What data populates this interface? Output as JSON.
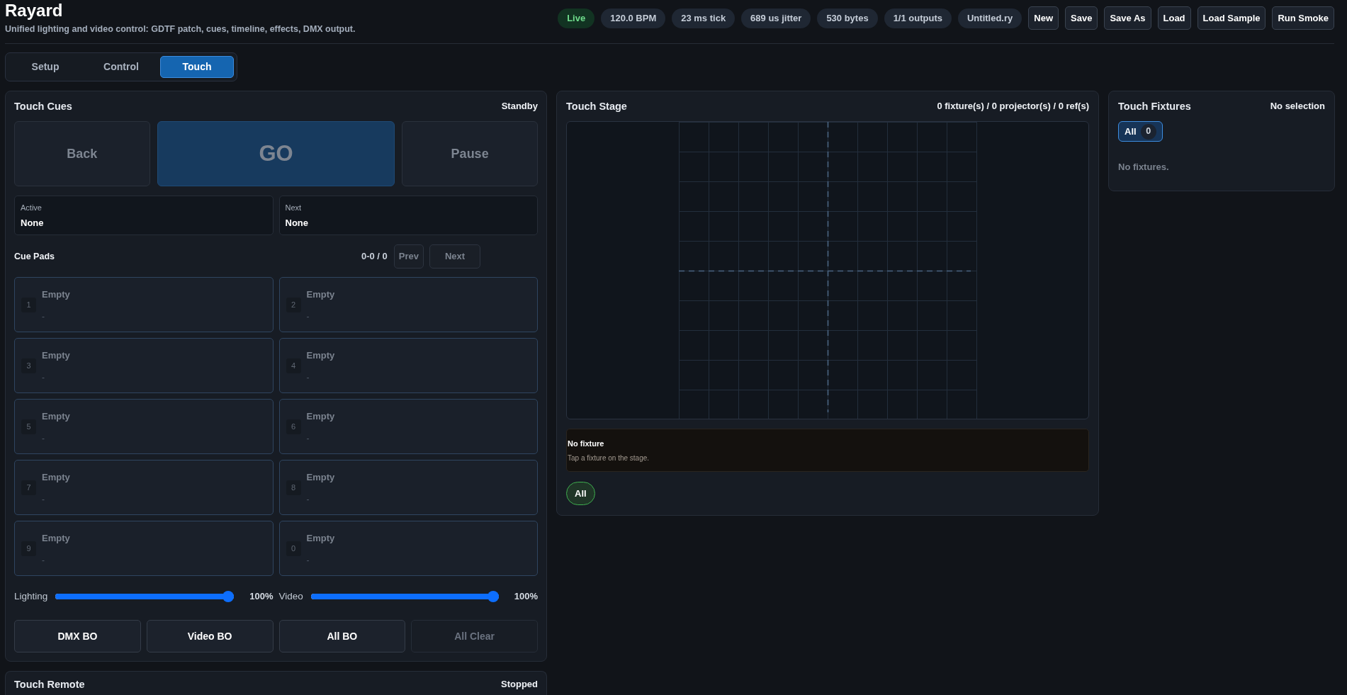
{
  "app": {
    "title": "Rayard",
    "subtitle": "Unified lighting and video control: GDTF patch, cues, timeline, effects, DMX output."
  },
  "status_chips": [
    {
      "kind": "live",
      "text": "Live"
    },
    {
      "kind": "info",
      "text": "120.0 BPM"
    },
    {
      "kind": "info",
      "text": "23 ms tick"
    },
    {
      "kind": "info",
      "text": "689 us jitter"
    },
    {
      "kind": "info",
      "text": "530 bytes"
    },
    {
      "kind": "info",
      "text": "1/1 outputs"
    },
    {
      "kind": "info",
      "text": "Untitled.ry"
    }
  ],
  "toolbar_buttons": [
    "New",
    "Save",
    "Save As",
    "Load",
    "Load Sample",
    "Run Smoke"
  ],
  "tabs": [
    {
      "label": "Setup",
      "selected": false
    },
    {
      "label": "Control",
      "selected": false
    },
    {
      "label": "Touch",
      "selected": true
    }
  ],
  "touch_cues": {
    "title": "Touch Cues",
    "status": "Standby",
    "transport": [
      {
        "kind": "secondary",
        "label": "Back",
        "disabled": true
      },
      {
        "kind": "primary",
        "label": "GO",
        "disabled": true
      },
      {
        "kind": "secondary",
        "label": "Pause",
        "disabled": true
      }
    ],
    "cue_slots": [
      {
        "label": "Active",
        "value": "None"
      },
      {
        "label": "Next",
        "value": "None"
      }
    ],
    "cue_pads": {
      "title": "Cue Pads",
      "range": "0-0 / 0",
      "prev": {
        "label": "Prev",
        "disabled": true
      },
      "next": {
        "label": "Next",
        "disabled": true
      },
      "pads": [
        {
          "number": "1",
          "label": "Empty",
          "detail": "-"
        },
        {
          "number": "2",
          "label": "Empty",
          "detail": "-"
        },
        {
          "number": "3",
          "label": "Empty",
          "detail": "-"
        },
        {
          "number": "4",
          "label": "Empty",
          "detail": "-"
        },
        {
          "number": "5",
          "label": "Empty",
          "detail": "-"
        },
        {
          "number": "6",
          "label": "Empty",
          "detail": "-"
        },
        {
          "number": "7",
          "label": "Empty",
          "detail": "-"
        },
        {
          "number": "8",
          "label": "Empty",
          "detail": "-"
        },
        {
          "number": "9",
          "label": "Empty",
          "detail": "-"
        },
        {
          "number": "0",
          "label": "Empty",
          "detail": "-"
        }
      ]
    },
    "faders": [
      {
        "label": "Lighting",
        "level": 1,
        "reading": "100%"
      },
      {
        "label": "Video",
        "level": 1,
        "reading": "100%"
      }
    ],
    "blackout_buttons": [
      {
        "label": "DMX BO",
        "disabled": false
      },
      {
        "label": "Video BO",
        "disabled": false
      },
      {
        "label": "All BO",
        "disabled": false
      },
      {
        "label": "All Clear",
        "disabled": true
      }
    ]
  },
  "touch_remote": {
    "title": "Touch Remote",
    "status": "Stopped"
  },
  "touch_stage": {
    "title": "Touch Stage",
    "summary": "0 fixture(s) / 0 projector(s) / 0 ref(s)",
    "info": {
      "title": "No fixture",
      "hint": "Tap a fixture on the stage."
    },
    "filters": [
      {
        "label": "All",
        "selected": true
      }
    ]
  },
  "touch_fixtures": {
    "title": "Touch Fixtures",
    "status": "No selection",
    "groups": [
      {
        "label": "All",
        "count": "0",
        "selected": true
      }
    ],
    "empty_text": "No fixtures."
  }
}
